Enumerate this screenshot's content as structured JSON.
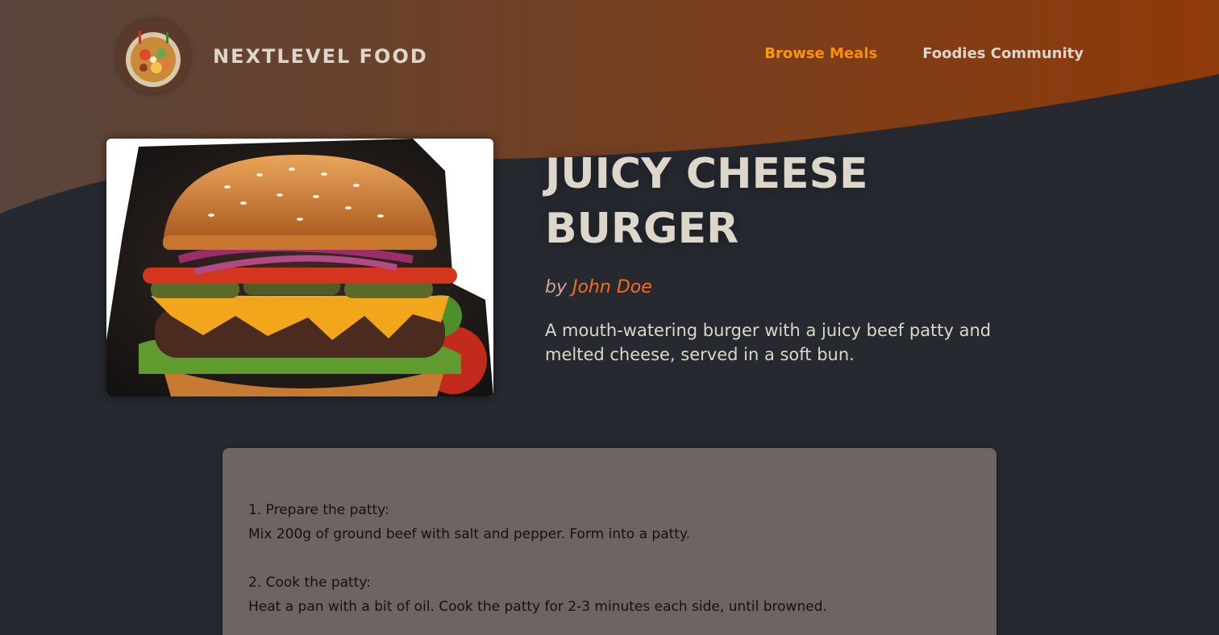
{
  "header": {
    "logo_alt": "A plate with food on it",
    "brand": "NextLevel Food",
    "nav": [
      {
        "label": "Browse Meals",
        "active": true
      },
      {
        "label": "Foodies Community",
        "active": false
      }
    ]
  },
  "meal": {
    "title": "Juicy Cheese Burger",
    "by_prefix": "by",
    "creator": "John Doe",
    "summary": "A mouth-watering burger with a juicy beef patty and melted cheese, served in a soft bun.",
    "image_alt": "Juicy Cheese Burger"
  },
  "instructions": [
    {
      "heading": "1. Prepare the patty:",
      "body": "Mix 200g of ground beef with salt and pepper. Form into a patty."
    },
    {
      "heading": "2. Cook the patty:",
      "body": "Heat a pan with a bit of oil. Cook the patty for 2-3 minutes each side, until browned."
    }
  ],
  "colors": {
    "background": "#262930",
    "header_gradient_start": "#59453c",
    "header_gradient_end": "#8f3a09",
    "accent": "#f99f2a",
    "creator_link": "#f76d1c",
    "instructions_bg": "#6e6464"
  }
}
